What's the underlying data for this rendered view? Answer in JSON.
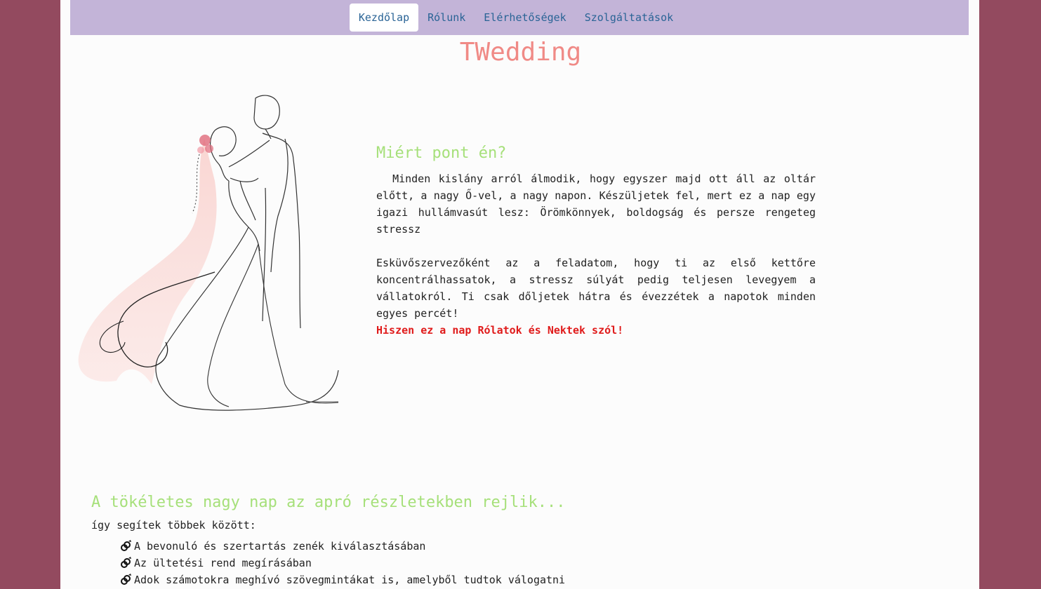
{
  "nav": {
    "items": [
      {
        "label": "Kezdőlap",
        "active": true
      },
      {
        "label": "Rólunk",
        "active": false
      },
      {
        "label": "Elérhetőségek",
        "active": false
      },
      {
        "label": "Szolgáltatások",
        "active": false
      }
    ]
  },
  "site": {
    "title": "TWedding"
  },
  "intro": {
    "heading": "Miért pont én?",
    "paragraph1": "  Minden kislány arról álmodik, hogy egyszer majd ott áll az oltár előtt, a nagy Ő-vel, a nagy napon. Készüljetek fel, mert ez a nap egy igazi hullámvasút lesz: Örömkönnyek, boldogság és persze rengeteg stressz",
    "paragraph2": "Esküvőszervezőként az a feladatom, hogy ti az első kettőre koncentrálhassatok, a stressz súlyát pedig teljesen levegyem a vállatokról. Ti csak dőljetek hátra és évezzétek a napotok minden egyes percét!",
    "highlight": "Hiszen ez a nap Rólatok és Nektek szól!"
  },
  "details": {
    "heading": "A tökéletes nagy nap az apró részletekben rejlik...",
    "subheading": "így segítek többek között:",
    "items": [
      "A bevonuló és szertartás zenék kiválasztásában",
      "Az ültetési rend megírásában",
      "Adok számotokra meghívó szövegmintákat is, amelyből tudtok válogatni"
    ]
  },
  "colors": {
    "background": "#934a5f",
    "navbar": "#c3b4d8",
    "title": "#f08a86",
    "heading": "#a6e07a",
    "highlight": "#e01b1b",
    "link": "#2a6496"
  }
}
